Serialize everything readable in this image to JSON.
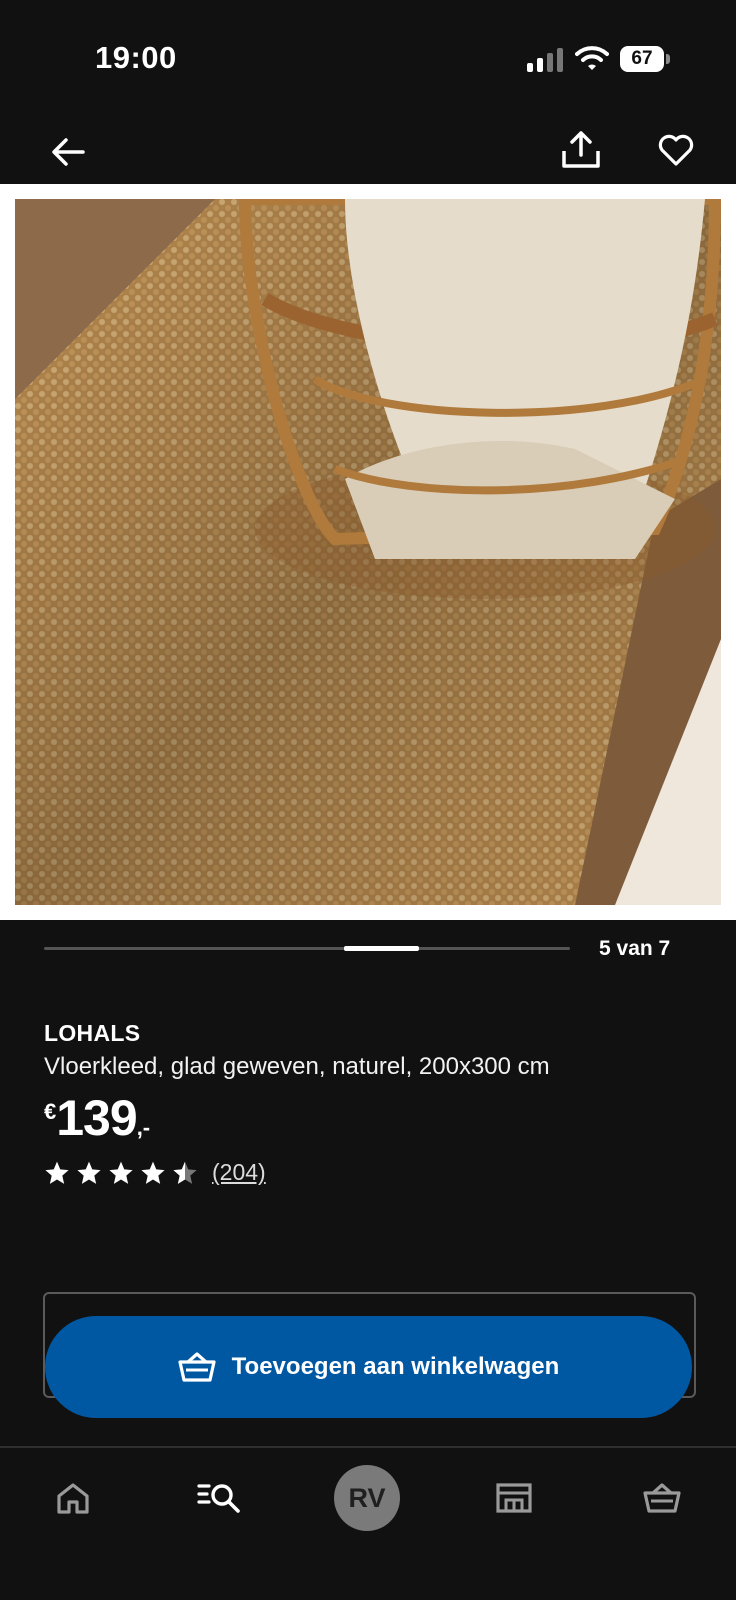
{
  "status_bar": {
    "time": "19:00",
    "battery": "67"
  },
  "nav": {
    "icons": [
      "back-arrow-icon",
      "share-icon",
      "heart-icon"
    ]
  },
  "product_image": {
    "description_icon": "product-photo"
  },
  "carousel": {
    "counter": "5 van 7",
    "current": 5,
    "total": 7
  },
  "product": {
    "brand": "LOHALS",
    "description": "Vloerkleed, glad geweven, naturel, 200x300 cm",
    "price": {
      "currency": "€",
      "amount": "139",
      "suffix": ",-"
    },
    "rating": 4.5,
    "reviews": "(204)"
  },
  "cart_button": {
    "label": "Toevoegen aan winkelwagen",
    "color": "#0058a3"
  },
  "tab_bar": {
    "avatar_initials": "RV",
    "items": [
      "home-icon",
      "search-icon",
      "profile-avatar",
      "store-icon",
      "cart-icon"
    ]
  }
}
